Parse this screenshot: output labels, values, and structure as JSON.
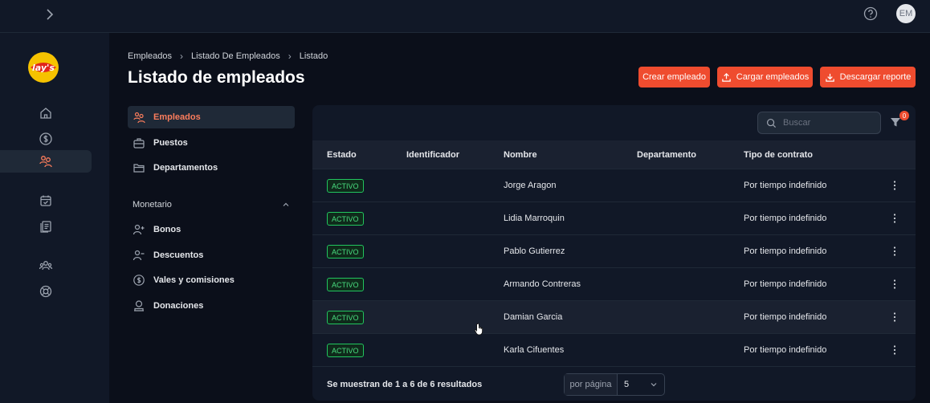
{
  "topbar": {
    "avatar_initials": "EM"
  },
  "breadcrumb": [
    "Empleados",
    "Listado De Empleados",
    "Listado"
  ],
  "page": {
    "title": "Listado de empleados"
  },
  "actions": {
    "create": "Crear empleado",
    "upload": "Cargar empleados",
    "download": "Descargar reporte"
  },
  "subnav": {
    "items": [
      "Empleados",
      "Puestos",
      "Departamentos"
    ],
    "group_label": "Monetario",
    "group_items": [
      "Bonos",
      "Descuentos",
      "Vales y comisiones",
      "Donaciones"
    ]
  },
  "table": {
    "search_placeholder": "Buscar",
    "filter_count": "0",
    "columns": [
      "Estado",
      "Identificador",
      "Nombre",
      "Departamento",
      "Tipo de contrato"
    ],
    "rows": [
      {
        "status": "ACTIVO",
        "name": "Jorge Aragon",
        "contract": "Por tiempo indefinido"
      },
      {
        "status": "ACTIVO",
        "name": "Lidia Marroquin",
        "contract": "Por tiempo indefinido"
      },
      {
        "status": "ACTIVO",
        "name": "Pablo Gutierrez",
        "contract": "Por tiempo indefinido"
      },
      {
        "status": "ACTIVO",
        "name": "Armando Contreras",
        "contract": "Por tiempo indefinido"
      },
      {
        "status": "ACTIVO",
        "name": "Damian Garcia",
        "contract": "Por tiempo indefinido"
      },
      {
        "status": "ACTIVO",
        "name": "Karla Cifuentes",
        "contract": "Por tiempo indefinido"
      }
    ],
    "footer": "Se muestran de 1 a 6 de 6 resultados",
    "per_page_label": "por página",
    "per_page_value": "5"
  },
  "colors": {
    "accent": "#ef4c2f",
    "active_text": "#fb7d5c",
    "status_green": "#4ade80"
  }
}
